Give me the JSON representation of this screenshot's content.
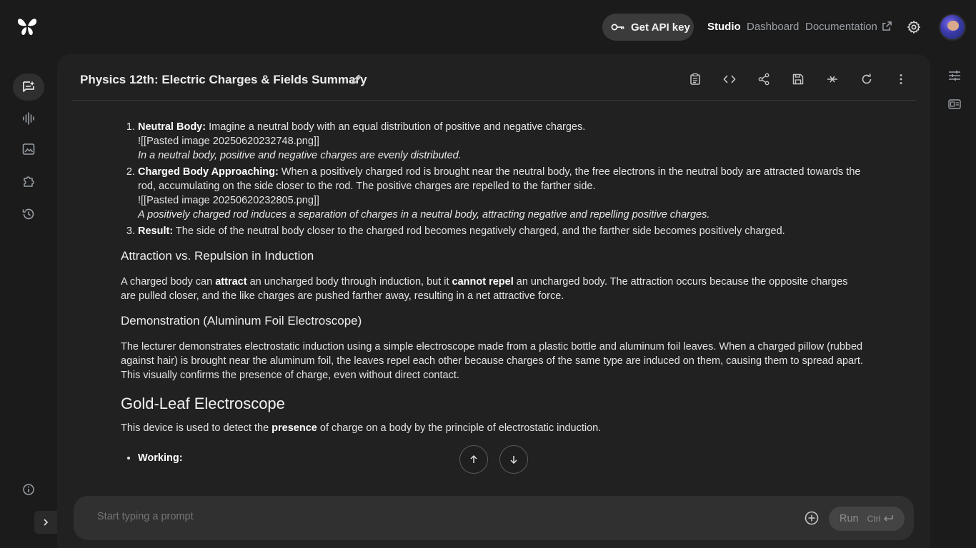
{
  "topbar": {
    "api_button": "Get API key",
    "nav": [
      "Studio",
      "Dashboard",
      "Documentation"
    ]
  },
  "panel": {
    "title": "Physics 12th: Electric Charges & Fields Summary"
  },
  "content": {
    "list1": [
      {
        "bold": "Neutral Body:",
        "text": " Imagine a neutral body with an equal distribution of positive and negative charges.",
        "line2": "![[Pasted image 20250620232748.png]]",
        "italic": "In a neutral body, positive and negative charges are evenly distributed."
      },
      {
        "bold": "Charged Body Approaching:",
        "text": " When a positively charged rod is brought near the neutral body, the free electrons in the neutral body are attracted towards the rod, accumulating on the side closer to the rod. The positive charges are repelled to the farther side.",
        "line2": "![[Pasted image 20250620232805.png]]",
        "italic": "A positively charged rod induces a separation of charges in a neutral body, attracting negative and repelling positive charges."
      },
      {
        "bold": "Result:",
        "text": " The side of the neutral body closer to the charged rod becomes negatively charged, and the farther side becomes positively charged."
      }
    ],
    "h_attraction": "Attraction vs. Repulsion in Induction",
    "p_attraction": {
      "a": "A charged body can ",
      "b1": "attract",
      "c": " an uncharged body through induction, but it ",
      "b2": "cannot repel",
      "d": " an uncharged body. The attraction occurs because the opposite charges are pulled closer, and the like charges are pushed farther away, resulting in a net attractive force."
    },
    "h_demo": "Demonstration (Aluminum Foil Electroscope)",
    "p_demo": "The lecturer demonstrates electrostatic induction using a simple electroscope made from a plastic bottle and aluminum foil leaves. When a charged pillow (rubbed against hair) is brought near the aluminum foil, the leaves repel each other because charges of the same type are induced on them, causing them to spread apart. This visually confirms the presence of charge, even without direct contact.",
    "h_gold": "Gold-Leaf Electroscope",
    "p_gold": {
      "a": "This device is used to detect the ",
      "b": "presence",
      "c": " of charge on a body by the principle of electrostatic induction."
    },
    "working": "Working:"
  },
  "prompt": {
    "placeholder": "Start typing a prompt",
    "run": "Run",
    "kbd": "Ctrl"
  }
}
